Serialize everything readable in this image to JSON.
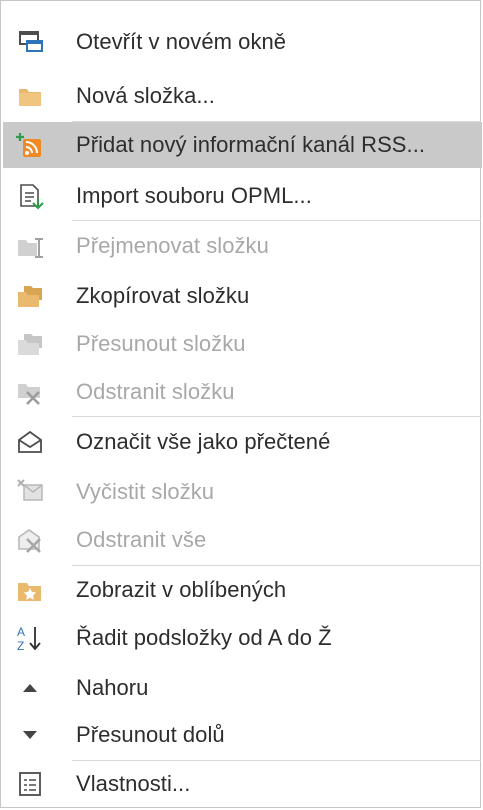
{
  "menu": {
    "items": [
      {
        "label": "Otevřít v novém okně",
        "icon": "new-window-icon",
        "disabled": false
      },
      {
        "label": "Nová složka...",
        "icon": "folder-icon",
        "disabled": false
      },
      {
        "label": "Přidat nový informační kanál RSS...",
        "icon": "add-rss-feed-icon",
        "disabled": false,
        "hovered": true
      },
      {
        "label": "Import souboru OPML...",
        "icon": "import-opml-icon",
        "disabled": false
      },
      {
        "label": "Přejmenovat složku",
        "icon": "rename-folder-icon",
        "disabled": true
      },
      {
        "label": "Zkopírovat složku",
        "icon": "copy-folder-icon",
        "disabled": false
      },
      {
        "label": "Přesunout složku",
        "icon": "move-folder-icon",
        "disabled": true
      },
      {
        "label": "Odstranit složku",
        "icon": "delete-folder-icon",
        "disabled": true
      },
      {
        "label": "Označit vše jako přečtené",
        "icon": "mark-all-read-icon",
        "disabled": false
      },
      {
        "label": "Vyčistit složku",
        "icon": "clean-up-folder-icon",
        "disabled": true
      },
      {
        "label": "Odstranit vše",
        "icon": "delete-all-icon",
        "disabled": true
      },
      {
        "label": "Zobrazit v oblíbených",
        "icon": "favorites-icon",
        "disabled": false
      },
      {
        "label": "Řadit podsložky od A do Ž",
        "icon": "sort-a-to-z-icon",
        "disabled": false
      },
      {
        "label": "Nahoru",
        "icon": "up-arrow-icon",
        "disabled": false
      },
      {
        "label": "Přesunout dolů",
        "icon": "down-arrow-icon",
        "disabled": false
      },
      {
        "label": "Vlastnosti...",
        "icon": "properties-icon",
        "disabled": false
      }
    ]
  },
  "colors": {
    "hover_background": "#c9c9c9",
    "enabled_text": "#2d2d2d",
    "disabled_text": "#a8a8a8",
    "separator": "#d9d9d9",
    "rss_orange": "#f08a24",
    "folder_tan": "#e9b96e"
  }
}
